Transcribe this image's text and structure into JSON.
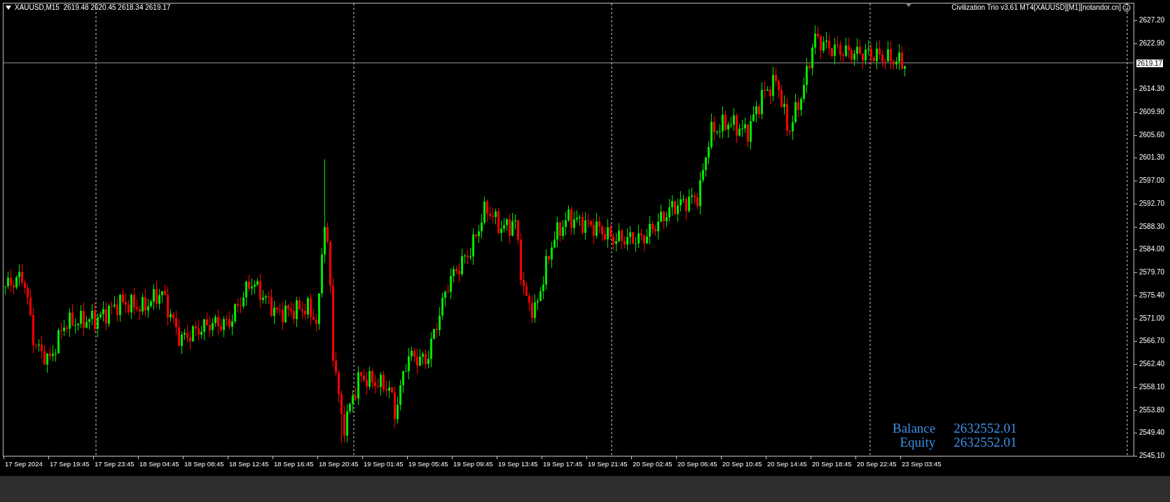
{
  "chart": {
    "header": "XAUUSD,M15  2619.48 2620.45 2618.34 2619.17",
    "indicator_label": "Civilization Trio v3.61 MT4[XAUUSD][M1][notandor.cn]",
    "price_axis": [
      "2627.20",
      "2622.90",
      "2614.30",
      "2609.90",
      "2605.60",
      "2601.30",
      "2597.00",
      "2592.70",
      "2588.30",
      "2584.00",
      "2579.70",
      "2575.40",
      "2571.00",
      "2566.70",
      "2562.40",
      "2558.10",
      "2553.80",
      "2549.40",
      "2545.10"
    ],
    "current_price": "2619.17",
    "time_axis": [
      "17 Sep 2024",
      "17 Sep 19:45",
      "17 Sep 23:45",
      "18 Sep 04:45",
      "18 Sep 08:45",
      "18 Sep 12:45",
      "18 Sep 16:45",
      "18 Sep 20:45",
      "19 Sep 01:45",
      "19 Sep 05:45",
      "19 Sep 09:45",
      "19 Sep 13:45",
      "19 Sep 17:45",
      "19 Sep 21:45",
      "20 Sep 02:45",
      "20 Sep 06:45",
      "20 Sep 10:45",
      "20 Sep 14:45",
      "20 Sep 18:45",
      "20 Sep 22:45",
      "23 Sep 03:45"
    ],
    "account": [
      {
        "label": "Balance",
        "value": "2632552.01"
      },
      {
        "label": "Equity",
        "value": "2632552.01"
      }
    ]
  }
}
